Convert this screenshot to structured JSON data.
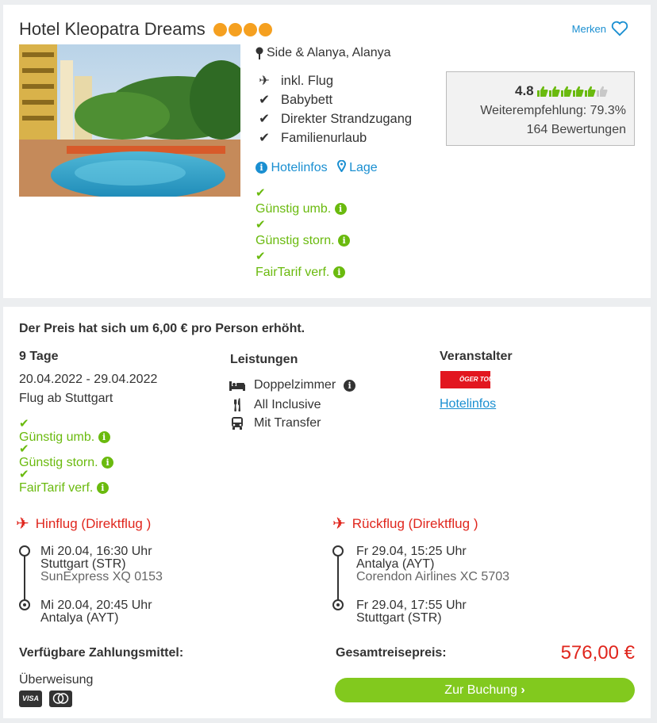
{
  "hotel": {
    "name": "Hotel Kleopatra Dreams",
    "stars": 4,
    "location": "Side & Alanya, Alanya",
    "merken": "Merken",
    "features": [
      "inkl. Flug",
      "Babybett",
      "Direkter Strandzugang",
      "Familienurlaub"
    ],
    "links": {
      "hotelinfos": "Hotelinfos",
      "lage": "Lage"
    },
    "badges": [
      "Günstig umb.",
      "Günstig storn.",
      "FairTarif verf."
    ],
    "rating": {
      "score": "4.8",
      "thumbs_full": 5,
      "recommendation": "Weiterempfehlung: 79.3%",
      "reviews": "164 Bewertungen"
    }
  },
  "offer": {
    "notice": "Der Preis hat sich um 6,00 € pro Person erhöht.",
    "duration": "9 Tage",
    "dates": "20.04.2022 - 29.04.2022",
    "departure": "Flug ab Stuttgart",
    "badges": [
      "Günstig umb.",
      "Günstig storn.",
      "FairTarif verf."
    ],
    "services_title": "Leistungen",
    "services": [
      "Doppelzimmer",
      "All Inclusive",
      "Mit Transfer"
    ],
    "operator_title": "Veranstalter",
    "operator_logo": "ÖGER TOURS",
    "operator_link": "Hotelinfos"
  },
  "outbound": {
    "title": "Hinflug (Direktflug )",
    "dep_time": "Mi 20.04, 16:30 Uhr",
    "dep_airport": "Stuttgart (STR)",
    "airline": "SunExpress XQ 0153",
    "arr_time": "Mi 20.04, 20:45 Uhr",
    "arr_airport": "Antalya (AYT)"
  },
  "return": {
    "title": "Rückflug (Direktflug )",
    "dep_time": "Fr 29.04, 15:25 Uhr",
    "dep_airport": "Antalya (AYT)",
    "airline": "Corendon Airlines XC 5703",
    "arr_time": "Fr 29.04, 17:55 Uhr",
    "arr_airport": "Stuttgart (STR)"
  },
  "payment": {
    "title": "Verfügbare Zahlungsmittel:",
    "method": "Überweisung",
    "cards": [
      "VISA",
      "Mastercard"
    ]
  },
  "price": {
    "label": "Gesamtreisepreis:",
    "value": "576,00 €",
    "button": "Zur Buchung"
  },
  "colors": {
    "green": "#6aba0e",
    "blue": "#1a8fd1",
    "red": "#e0261d",
    "star": "#f5a020"
  }
}
